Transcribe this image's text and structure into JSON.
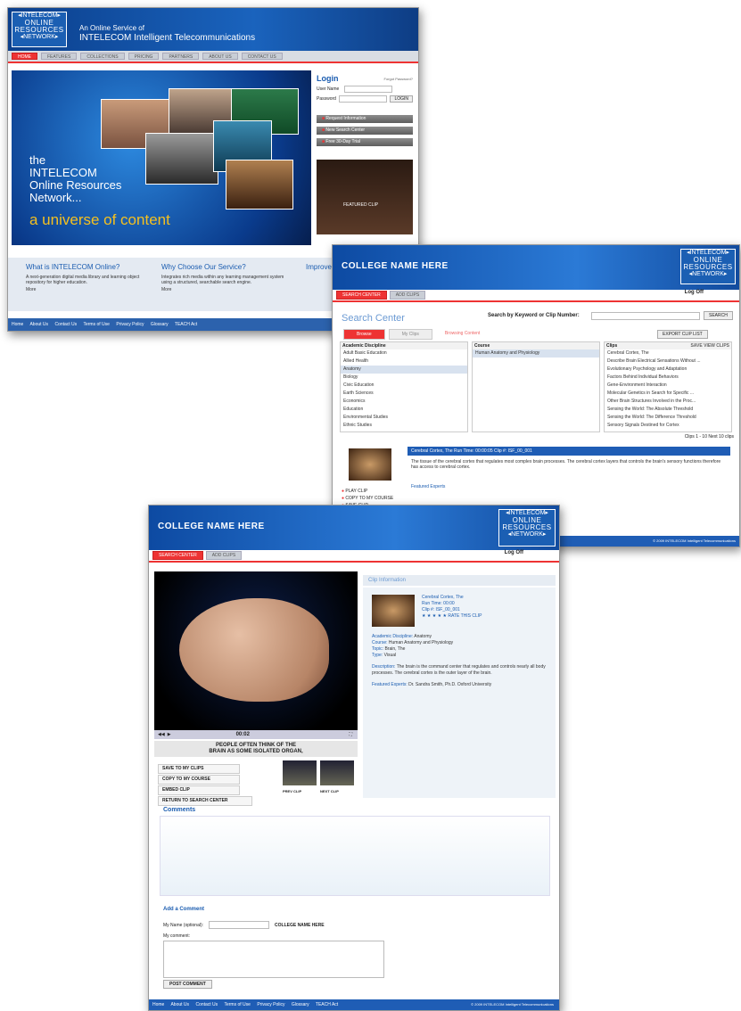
{
  "logo": {
    "line1": "◂INTELECOM▸",
    "line2": "ONLINE",
    "line3": "RESOURCES",
    "line4": "◂NETWORK▸"
  },
  "home": {
    "tagline": "An Online Service of",
    "tagline2": "INTELECOM Intelligent Telecommunications",
    "nav": [
      "HOME",
      "FEATURES",
      "COLLECTIONS",
      "PRICING",
      "PARTNERS",
      "ABOUT US",
      "CONTACT US"
    ],
    "hero_line1": "the",
    "hero_line2": "INTELECOM",
    "hero_line3": "Online Resources",
    "hero_line4": "Network...",
    "hero_line5": "a universe of content",
    "login_title": "Login",
    "login_forgot": "Forgot Password?",
    "login_user": "User Name",
    "login_pass": "Password",
    "login_btn": "LOGIN",
    "side_buttons": [
      "Request Information",
      "New Search Center",
      "Free 30-Day Trial"
    ],
    "clip_label": "FEATURED CLIP",
    "col1_h": "What is INTELECOM Online?",
    "col1_p": "A next-generation digital media library and learning object repository for higher education.",
    "col2_h": "Why Choose Our Service?",
    "col2_p": "Integrates rich media within any learning management system using a structured, searchable search engine.",
    "col3_h": "Improve",
    "more": "More",
    "footer": [
      "Home",
      "About Us",
      "Contact Us",
      "Terms of Use",
      "Privacy Policy",
      "Glossary",
      "TEACH Act"
    ]
  },
  "search": {
    "college": "COLLEGE NAME HERE",
    "tabs_top": [
      "SEARCH CENTER",
      "ADD CLIPS"
    ],
    "logoff": "Log Off",
    "title": "Search Center",
    "kw_label": "Search by Keyword or Clip Number:",
    "kw_btn": "SEARCH",
    "tabs": [
      "Browse",
      "My Clips",
      "Browsing Content"
    ],
    "export_btn": "EXPORT CLIP LIST",
    "col1_h": "Academic Discipline",
    "col1_items": [
      "Adult Basic Education",
      "Allied Health",
      "Anatomy",
      "Biology",
      "Civic Education",
      "Earth Sciences",
      "Economics",
      "Education",
      "Environmental Studies",
      "Ethnic Studies"
    ],
    "col2_h": "Course",
    "col2_items": [
      "Human Anatomy and Physiology"
    ],
    "col3_h": "Clips",
    "col3_save": "SAVE VIEW CLIPS",
    "col3_items": [
      "Cerebral Cortex, The",
      "Describe Brain Electrical Sensations Without ...",
      "Evolutionary Psychology and Adaptation",
      "Factors Behind Individual Behaviors",
      "Gene-Environment Interaction",
      "Molecular Genetics in Search for Specific ...",
      "Other Brain Structures Involved in the Proc...",
      "Sensing the World: The Absolute Threshold",
      "Sensing the World: The Difference Threshold",
      "Sensory Signals Destined for Cortex"
    ],
    "count": "Clips 1 - 10     Next 10 clips",
    "detail_bar": "Cerebral Cortex, The    Run Time: 00:00:05    Clip #: ISF_00_001",
    "detail_text": "The tissue of the cerebral cortex that regulates most complex brain processes. The cerebral cortex layers that controls the brain's sensory functions therefore has access to cerebral cortex.",
    "featured": "Featured Experts",
    "actions": [
      "PLAY CLIP",
      "COPY TO MY COURSE",
      "SAVE CLIP"
    ],
    "footer": "© 2009 INTELECOM Intelligent Telecommunications"
  },
  "clip": {
    "college": "COLLEGE NAME HERE",
    "logoff": "Log Off",
    "info_h": "Clip Information",
    "meta": [
      "Cerebral Cortex, The",
      "Run Time: 00:00",
      "Clip #: ISF_00_001",
      "★ ★ ★ ★ ★  RATE THIS CLIP"
    ],
    "rows": [
      {
        "k": "Academic Discipline:",
        "v": " Anatomy"
      },
      {
        "k": "Course:",
        "v": " Human Anatomy and Physiology"
      },
      {
        "k": "Topic:",
        "v": " Brain, The"
      },
      {
        "k": "Type:",
        "v": " Visual"
      },
      {
        "k": "Description:",
        "v": " The brain is the command center that regulates and controls nearly all body processes. The cerebral cortex is the outer layer of the brain."
      },
      {
        "k": "Featured Experts:",
        "v": " Dr. Sandra Smith, Ph.D. Oxford University"
      }
    ],
    "time": "00:02",
    "caption1": "PEOPLE OFTEN THINK OF THE",
    "caption2": "BRAIN AS SOME ISOLATED ORGAN,",
    "actions": [
      "SAVE TO MY CLIPS",
      "COPY TO MY COURSE",
      "EMBED CLIP",
      "RETURN TO SEARCH CENTER"
    ],
    "prev": "PREV CLIP",
    "next": "NEXT CLIP",
    "comments_h": "Comments",
    "add_h": "Add a Comment",
    "name_label": "My Name (optional):",
    "college_label": "COLLEGE NAME HERE",
    "my_comment": "My comment:",
    "post": "POST COMMENT",
    "footer": [
      "Home",
      "About Us",
      "Contact Us",
      "Terms of Use",
      "Privacy Policy",
      "Glossary",
      "TEACH Act"
    ],
    "footer_r": "© 2009 INTELECOM Intelligent Telecommunications"
  }
}
